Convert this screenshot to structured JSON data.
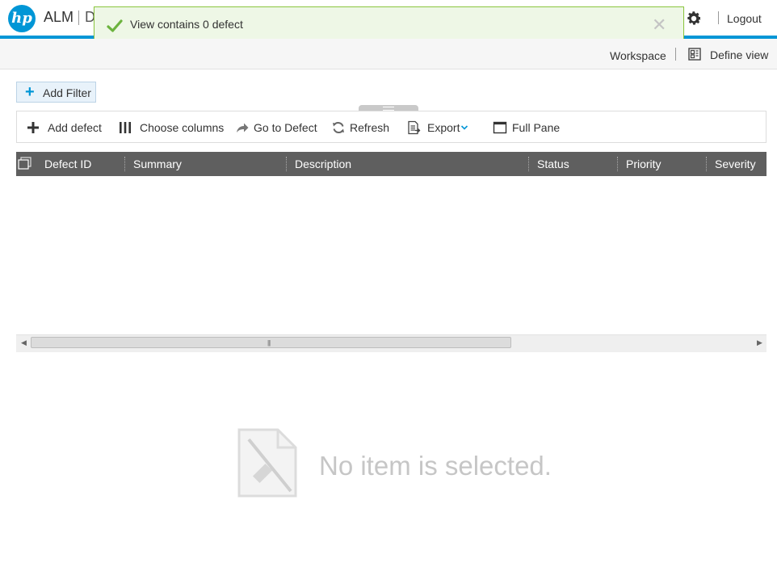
{
  "header": {
    "logo_text": "hp",
    "app_name": "ALM",
    "module_name": "D",
    "logout_label": "Logout"
  },
  "toast": {
    "message": "View contains 0 defect",
    "close_glyph": "✕"
  },
  "subbar": {
    "workspace_label": "Workspace",
    "define_view_label": "Define view"
  },
  "filter": {
    "add_filter_label": "Add Filter"
  },
  "toolbar": {
    "add_defect_label": "Add defect",
    "choose_columns_label": "Choose columns",
    "go_to_defect_label": "Go to Defect",
    "refresh_label": "Refresh",
    "export_label": "Export",
    "full_pane_label": "Full Pane"
  },
  "grid": {
    "columns": [
      "Defect ID",
      "Summary",
      "Description",
      "Status",
      "Priority",
      "Severity"
    ],
    "rows": []
  },
  "detail": {
    "empty_message": "No item is selected."
  },
  "colors": {
    "brand": "#0096d6",
    "toast_border": "#8cc63f",
    "toast_bg": "#eef7e6",
    "grid_header_bg": "#5f5f5f"
  }
}
